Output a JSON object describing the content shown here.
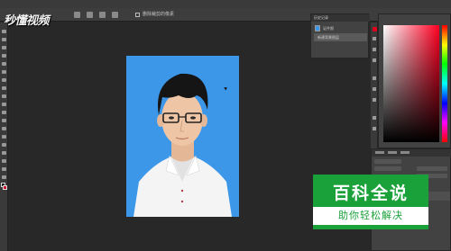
{
  "app": {
    "watermark_text": "秒懂视频",
    "options": {
      "layer_label": "删除裁剪的像素"
    },
    "history_panel": {
      "tab_label": "历史记录",
      "rows": [
        {
          "label": "证件照"
        },
        {
          "label": "新建背景图层"
        }
      ]
    },
    "colors": {
      "canvas_background": "#3d97e9",
      "foreground_swatch": "#000000",
      "background_swatch": "#c8102e",
      "brand_green": "#1aa13a"
    }
  },
  "brand_badge": {
    "title": "百科全说",
    "subtitle": "助你轻松解决"
  }
}
